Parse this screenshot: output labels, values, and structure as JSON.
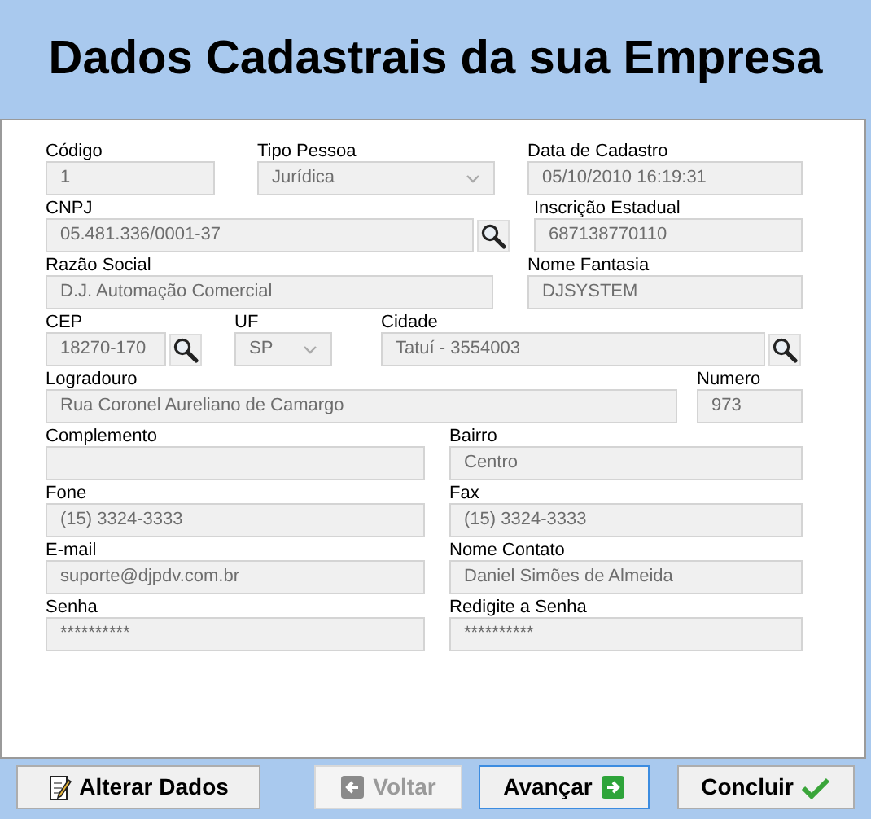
{
  "header": {
    "title": "Dados Cadastrais da sua Empresa"
  },
  "rows": [
    [
      {
        "label": "Código",
        "kind": "text",
        "value": "1"
      },
      {
        "label": "Tipo Pessoa",
        "kind": "select",
        "value": "Jurídica"
      },
      {
        "label": "Data de Cadastro",
        "kind": "text",
        "value": "05/10/2010 16:19:31"
      }
    ],
    [
      {
        "label": "CNPJ",
        "kind": "search",
        "value": "05.481.336/0001-37"
      },
      {
        "label": "Inscrição Estadual",
        "kind": "text",
        "value": "687138770110"
      }
    ],
    [
      {
        "label": "Razão Social",
        "kind": "text",
        "value": "D.J. Automação Comercial"
      },
      {
        "label": "Nome Fantasia",
        "kind": "text",
        "value": "DJSYSTEM"
      }
    ],
    [
      {
        "label": "CEP",
        "kind": "search",
        "value": "18270-170"
      },
      {
        "label": "UF",
        "kind": "select",
        "value": "SP"
      },
      {
        "label": "Cidade",
        "kind": "search",
        "value": "Tatuí - 3554003"
      }
    ],
    [
      {
        "label": "Logradouro",
        "kind": "text",
        "value": "Rua Coronel Aureliano de Camargo"
      },
      {
        "label": "Numero",
        "kind": "text",
        "value": "973"
      }
    ],
    [
      {
        "label": "Complemento",
        "kind": "text"
      },
      {
        "label": "Bairro",
        "kind": "text",
        "value": "Centro"
      }
    ],
    [
      {
        "label": "Fone",
        "kind": "text",
        "value": "(15) 3324-3333"
      },
      {
        "label": "Fax",
        "kind": "text",
        "value": "(15) 3324-3333"
      }
    ],
    [
      {
        "label": "E-mail",
        "kind": "text",
        "value": "suporte@djpdv.com.br"
      },
      {
        "label": "Nome Contato",
        "kind": "text",
        "value": "Daniel Simões de Almeida"
      }
    ],
    [
      {
        "label": "Senha",
        "kind": "text",
        "value": "**********"
      },
      {
        "label": "Redigite a Senha",
        "kind": "text",
        "value": "**********"
      }
    ]
  ],
  "buttons": [
    {
      "label": "Alterar Dados",
      "kind": "edit",
      "disabled": false,
      "focused": false
    },
    {
      "label": "Voltar",
      "kind": "back",
      "disabled": true,
      "focused": false
    },
    {
      "label": "Avançar",
      "kind": "forward",
      "disabled": false,
      "focused": true
    },
    {
      "label": "Concluir",
      "kind": "check",
      "disabled": false,
      "focused": false
    }
  ]
}
